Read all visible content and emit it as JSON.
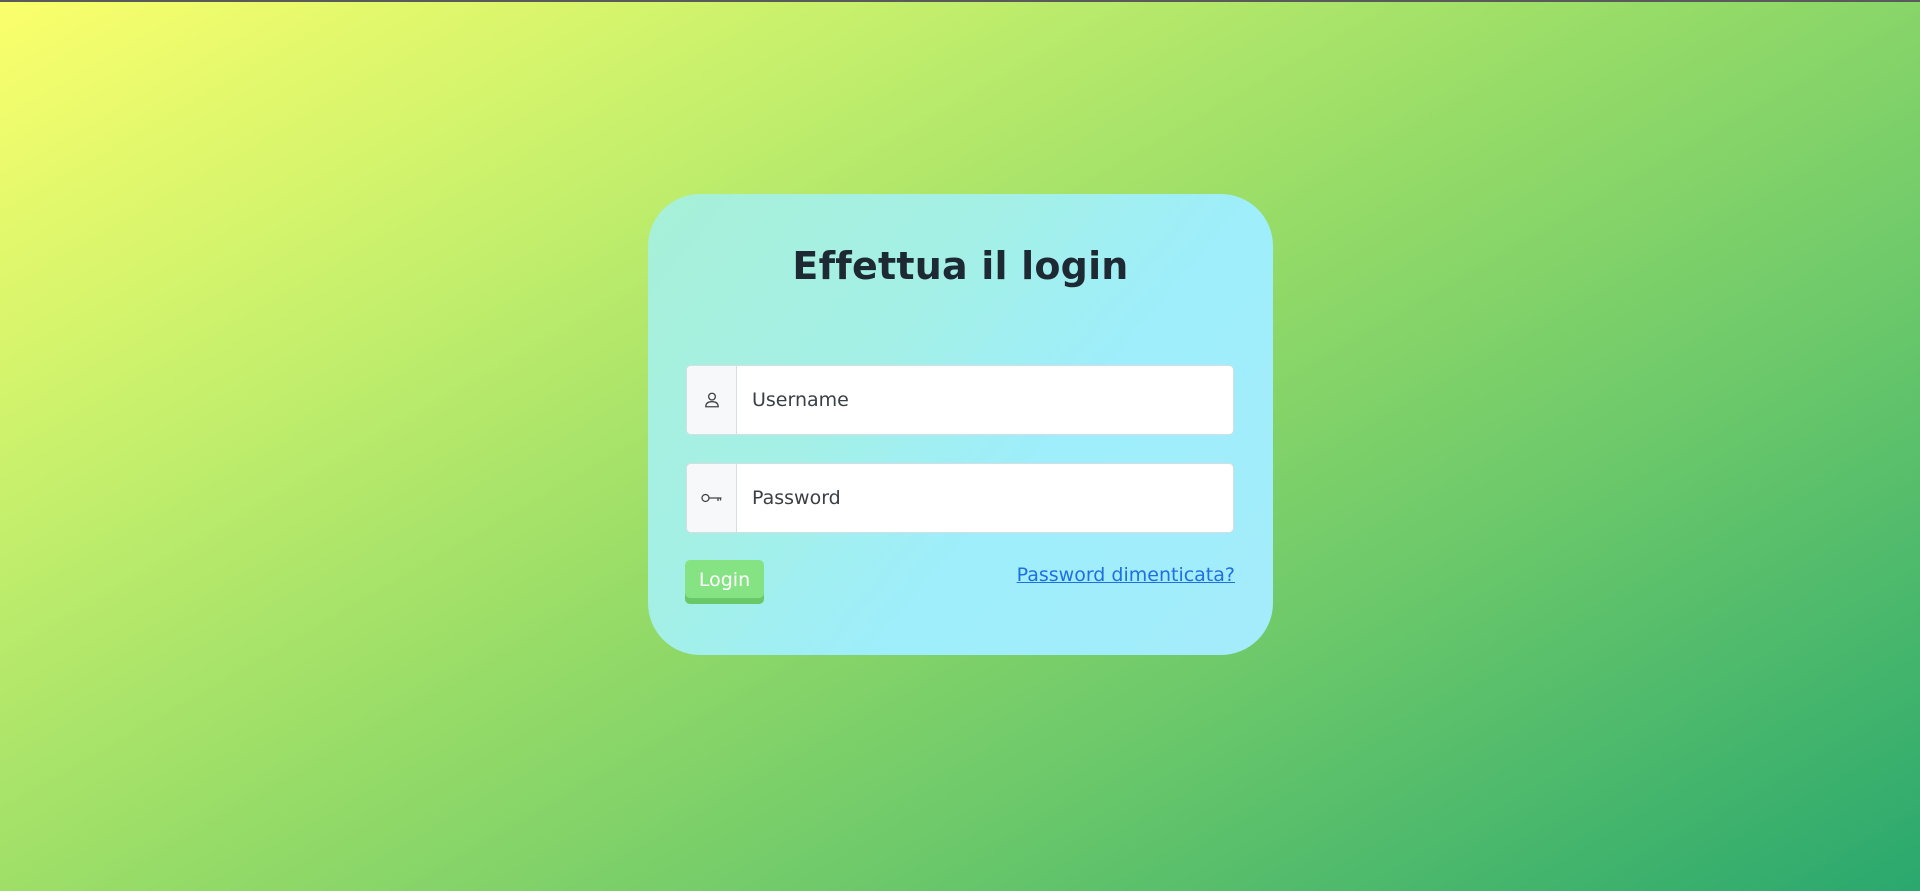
{
  "login": {
    "title": "Effettua il login",
    "username_placeholder": "Username",
    "password_placeholder": "Password",
    "button_label": "Login",
    "forgot_label": "Password dimenticata?",
    "username_icon": "person-icon",
    "password_icon": "key-icon"
  },
  "colors": {
    "button": "#86e383",
    "link": "#1f6fe0",
    "title": "#1e2a33"
  }
}
